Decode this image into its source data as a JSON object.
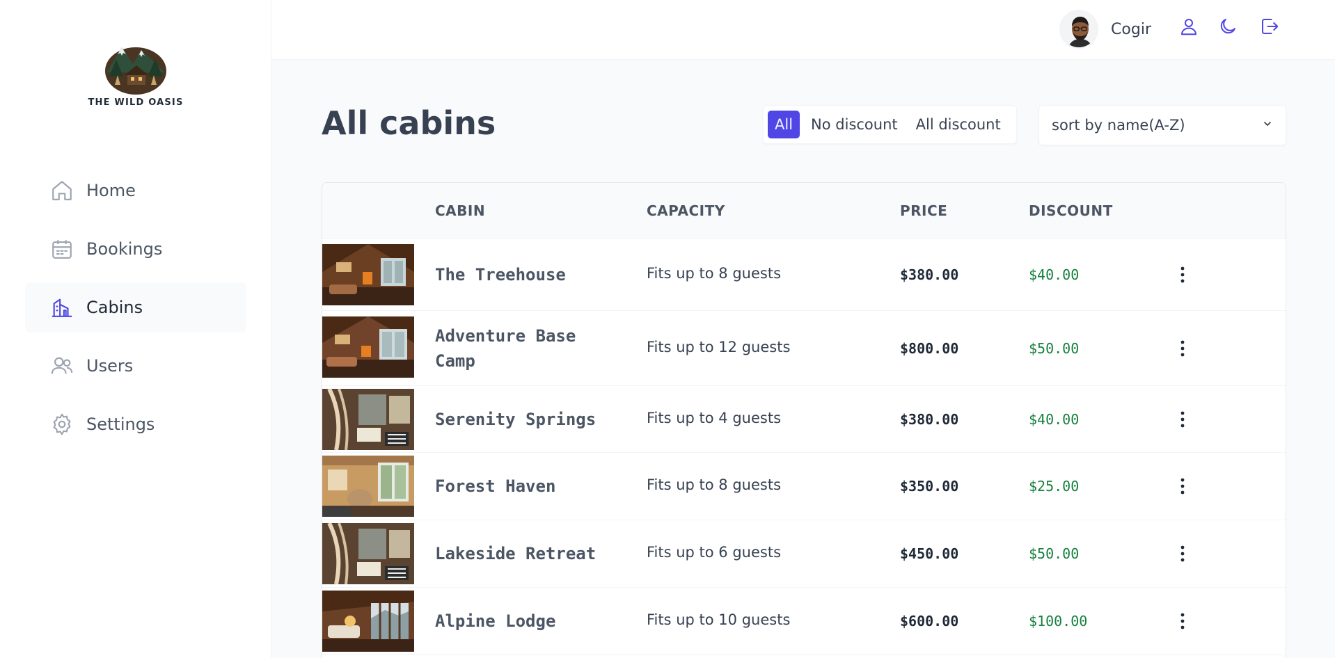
{
  "brand": {
    "logo_text": "THE WILD OASIS"
  },
  "sidebar": {
    "items": [
      {
        "label": "Home",
        "icon": "home-icon",
        "active": false
      },
      {
        "label": "Bookings",
        "icon": "calendar-icon",
        "active": false
      },
      {
        "label": "Cabins",
        "icon": "cabin-icon",
        "active": true
      },
      {
        "label": "Users",
        "icon": "users-icon",
        "active": false
      },
      {
        "label": "Settings",
        "icon": "gear-icon",
        "active": false
      }
    ]
  },
  "header": {
    "username": "Cogir",
    "icons": [
      "user-icon",
      "moon-icon",
      "logout-icon"
    ]
  },
  "main": {
    "title": "All cabins",
    "filters": [
      {
        "label": "All",
        "active": true
      },
      {
        "label": "No discount",
        "active": false
      },
      {
        "label": "All discount",
        "active": false
      }
    ],
    "sort": {
      "selected": "sort by name(A-Z)"
    }
  },
  "table": {
    "columns": [
      "CABIN",
      "CAPACITY",
      "PRICE",
      "DISCOUNT"
    ],
    "rows": [
      {
        "name": "The Treehouse",
        "capacity": "Fits up to 8 guests",
        "price": "$380.00",
        "discount": "$40.00"
      },
      {
        "name": "Adventure Base Camp",
        "capacity": "Fits up to 12 guests",
        "price": "$800.00",
        "discount": "$50.00"
      },
      {
        "name": "Serenity Springs",
        "capacity": "Fits up to 4 guests",
        "price": "$380.00",
        "discount": "$40.00"
      },
      {
        "name": "Forest Haven",
        "capacity": "Fits up to 8 guests",
        "price": "$350.00",
        "discount": "$25.00"
      },
      {
        "name": "Lakeside Retreat",
        "capacity": "Fits up to 6 guests",
        "price": "$450.00",
        "discount": "$50.00"
      },
      {
        "name": "Alpine Lodge",
        "capacity": "Fits up to 10 guests",
        "price": "$600.00",
        "discount": "$100.00"
      }
    ]
  },
  "colors": {
    "accent": "#4f46e5",
    "discount": "#15803d",
    "active_nav_bg": "#f9fafb"
  }
}
